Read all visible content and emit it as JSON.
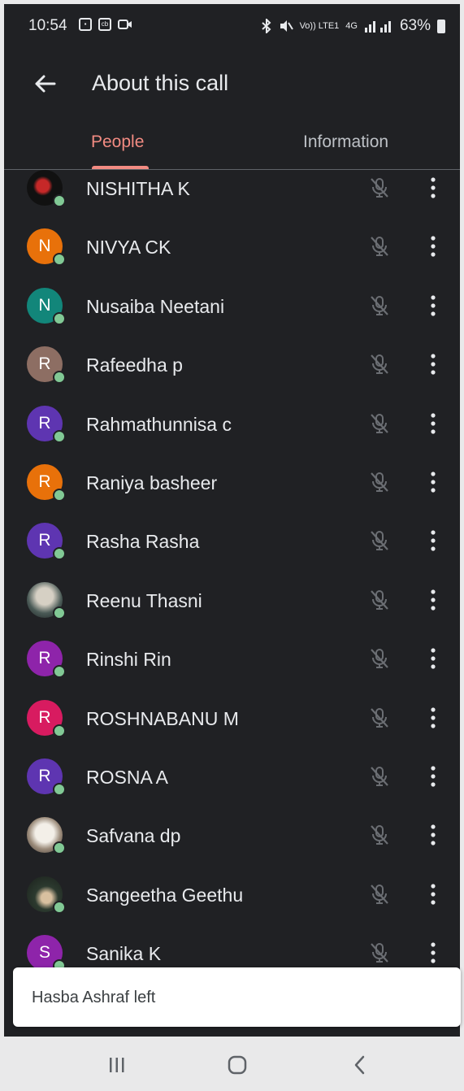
{
  "status_bar": {
    "time": "10:54",
    "battery": "63%",
    "network": "4G",
    "volte": "Vo)) LTE1"
  },
  "header": {
    "title": "About this call",
    "back_icon": "arrow-left-icon"
  },
  "tabs": [
    {
      "label": "People",
      "active": true
    },
    {
      "label": "Information",
      "active": false
    }
  ],
  "colors": {
    "background": "#202124",
    "active_tab": "#f28b82",
    "online": "#81c995"
  },
  "participants": [
    {
      "name": "NISHITHA K",
      "initial": "",
      "avatar_color": "photo",
      "muted": true
    },
    {
      "name": "NIVYA CK",
      "initial": "N",
      "avatar_color": "#e8710a",
      "muted": true
    },
    {
      "name": "Nusaiba Neetani",
      "initial": "N",
      "avatar_color": "#12867a",
      "muted": true
    },
    {
      "name": "Rafeedha p",
      "initial": "R",
      "avatar_color": "#8d6e63",
      "muted": true
    },
    {
      "name": "Rahmathunnisa c",
      "initial": "R",
      "avatar_color": "#5e35b1",
      "muted": true
    },
    {
      "name": "Raniya basheer",
      "initial": "R",
      "avatar_color": "#e8710a",
      "muted": true
    },
    {
      "name": "Rasha Rasha",
      "initial": "R",
      "avatar_color": "#5e35b1",
      "muted": true
    },
    {
      "name": "Reenu Thasni",
      "initial": "",
      "avatar_color": "photo2",
      "muted": true
    },
    {
      "name": "Rinshi Rin",
      "initial": "R",
      "avatar_color": "#8e24aa",
      "muted": true
    },
    {
      "name": "ROSHNABANU M",
      "initial": "R",
      "avatar_color": "#d81b60",
      "muted": true
    },
    {
      "name": "ROSNA A",
      "initial": "R",
      "avatar_color": "#5e35b1",
      "muted": true
    },
    {
      "name": "Safvana dp",
      "initial": "",
      "avatar_color": "photo3",
      "muted": true
    },
    {
      "name": "Sangeetha Geethu",
      "initial": "",
      "avatar_color": "photo4",
      "muted": true
    },
    {
      "name": "Sanika K",
      "initial": "S",
      "avatar_color": "#8e24aa",
      "muted": true
    }
  ],
  "snackbar": {
    "message": "Hasba Ashraf left"
  },
  "nav_bar": {
    "recents_icon": "recents-icon",
    "home_icon": "home-icon",
    "back_icon": "back-chevron-icon"
  }
}
